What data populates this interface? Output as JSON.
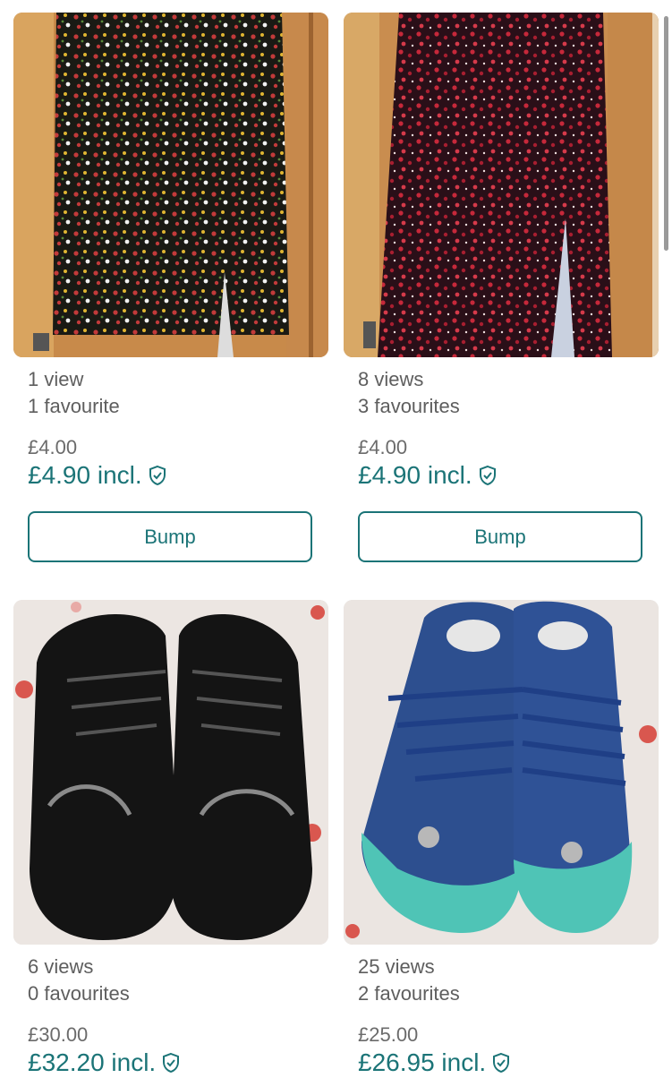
{
  "listings": [
    {
      "photo_alt": "floral-black-skirt",
      "views": "1 view",
      "favourites": "1 favourite",
      "price": "£4.00",
      "price_incl": "£4.90 incl.",
      "button_label": "Bump"
    },
    {
      "photo_alt": "floral-red-skirt",
      "views": "8 views",
      "favourites": "3 favourites",
      "price": "£4.00",
      "price_incl": "£4.90 incl.",
      "button_label": "Bump"
    },
    {
      "photo_alt": "black-patent-shoes",
      "views": "6 views",
      "favourites": "0 favourites",
      "price": "£30.00",
      "price_incl": "£32.20 incl."
    },
    {
      "photo_alt": "blue-glitter-sneakers",
      "views": "25 views",
      "favourites": "2 favourites",
      "price": "£25.00",
      "price_incl": "£26.95 incl."
    }
  ],
  "colors": {
    "accent": "#1b7477",
    "muted_text": "#5e5e5e"
  },
  "icons": {
    "buyer_protection": "shield-check-icon"
  }
}
